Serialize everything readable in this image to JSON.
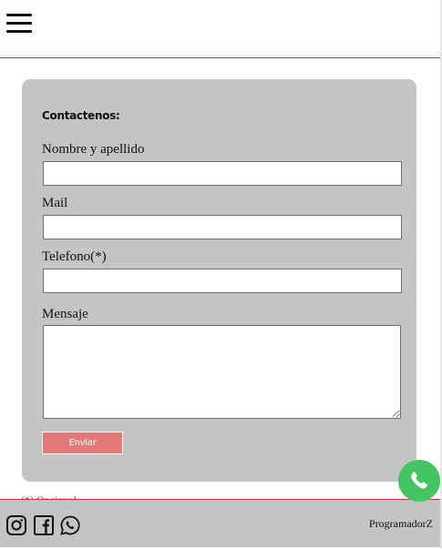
{
  "header": {
    "menu_icon": "hamburger-icon"
  },
  "form": {
    "title": "Contactenos:",
    "fields": [
      {
        "label": "Nombre y apellido",
        "value": "",
        "placeholder": ""
      },
      {
        "label": "Mail",
        "value": "",
        "placeholder": ""
      },
      {
        "label": "Telefono(*)",
        "value": "",
        "placeholder": ""
      }
    ],
    "message": {
      "label": "Mensaje",
      "value": ""
    },
    "submit_label": "Enviar",
    "required_note": "(*) Opcional"
  },
  "footer": {
    "icons": [
      "instagram-icon",
      "facebook-icon",
      "whatsapp-icon"
    ],
    "brand": "ProgramadorZ"
  },
  "floating": {
    "icon": "whatsapp-icon",
    "color": "#45c462"
  },
  "colors": {
    "accent_line": "#c8323c",
    "button": "#e27878",
    "panel": "#c4c4c4"
  }
}
